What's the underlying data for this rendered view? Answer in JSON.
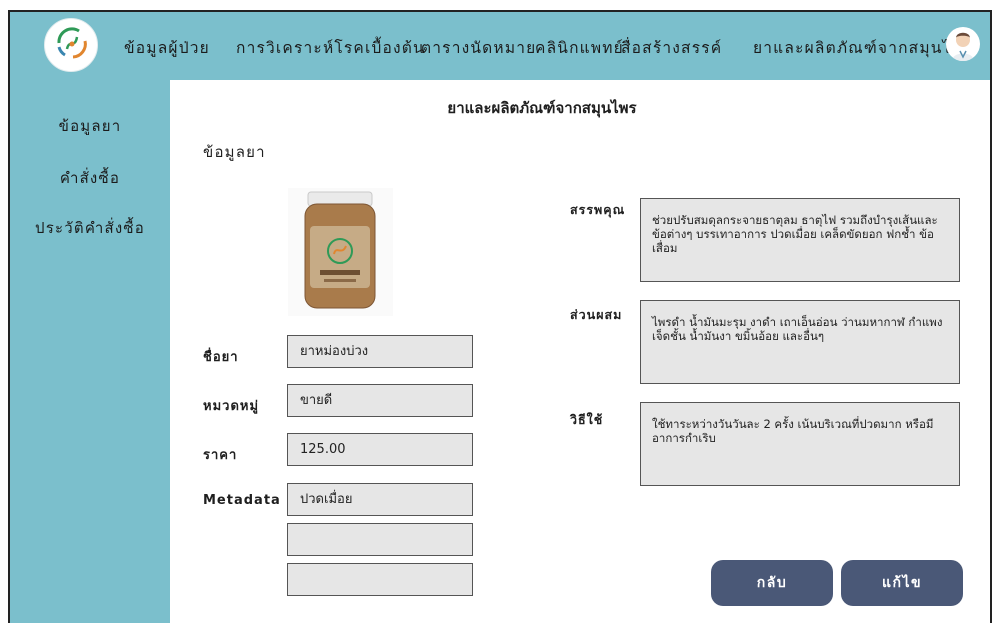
{
  "nav": {
    "items": [
      "ข้อมูลผู้ป่วย",
      "การวิเคราะห์โรคเบื้องต้น",
      "ตารางนัดหมาย",
      "คลินิกแพทย์",
      "สื่อสร้างสรรค์",
      "ยาและผลิตภัณฑ์จากสมุนไพร"
    ],
    "logo_icon": "herbal-clinic-logo",
    "avatar_icon": "doctor-avatar-icon"
  },
  "sidebar": {
    "items": [
      "ข้อมูลยา",
      "คำสั่งซื้อ",
      "ประวัติคำสั่งซื้อ"
    ]
  },
  "page_title": "ยาและผลิตภัณฑ์จากสมุนไพร",
  "section_title": "ข้อมูลยา",
  "fields": {
    "name": {
      "label": "ชื่อยา",
      "value": "ยาหม่องบ่วง"
    },
    "category": {
      "label": "หมวดหมู่",
      "value": "ขายดี"
    },
    "price": {
      "label": "ราคา",
      "value": "125.00"
    },
    "metadata": {
      "label": "Metadata",
      "values": [
        "ปวดเมื่อย",
        "",
        ""
      ]
    }
  },
  "details": {
    "benefits": {
      "label": "สรรพคุณ",
      "value": "ช่วยปรับสมดุลกระจายธาตุลม ธาตุไฟ รวมถึงบำรุงเส้นและข้อต่างๆ บรรเทาอาการ ปวดเมื่อย เคล็ดขัดยอก ฟกช้ำ ข้อเสื่อม"
    },
    "ingredients": {
      "label": "ส่วนผสม",
      "value": "ไพรดำ น้ำมันมะรุม งาดำ เถาเอ็นอ่อน ว่านมหากาฬ กำแพงเจ็ดชั้น น้ำมันงา ขมิ้นอ้อย และอื่นๆ"
    },
    "usage": {
      "label": "วิธีใช้",
      "value": "ใช้ทาระหว่างวันวันละ 2 ครั้ง เน้นบริเวณที่ปวดมาก หรือมีอาการกำเริบ"
    }
  },
  "buttons": {
    "back": "กลับ",
    "edit": "แก้ไข"
  },
  "colors": {
    "nav_bg": "#7bbfcc",
    "button_bg": "#4a5877",
    "field_bg": "#e6e6e6"
  }
}
